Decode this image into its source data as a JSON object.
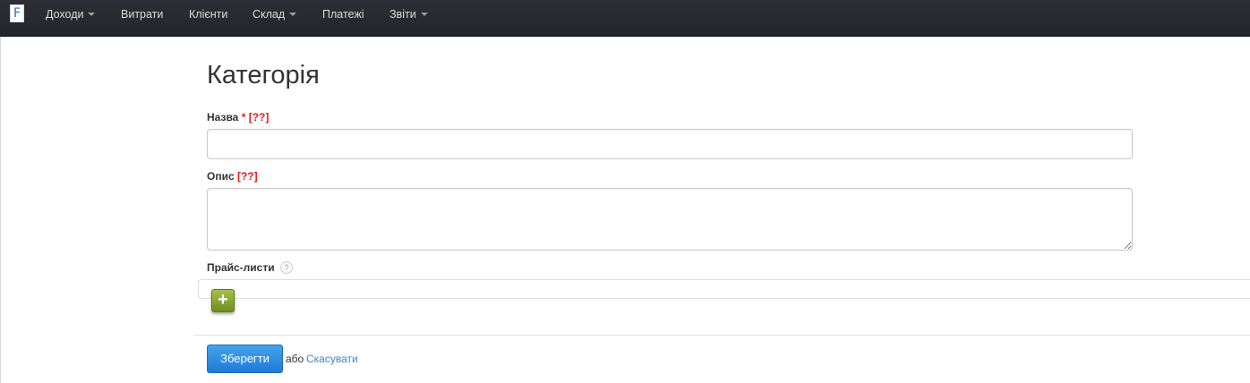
{
  "navbar": {
    "brand_glyph": "F",
    "items": [
      {
        "label": "Доходи",
        "dropdown": true
      },
      {
        "label": "Витрати",
        "dropdown": false
      },
      {
        "label": "Клієнти",
        "dropdown": false
      },
      {
        "label": "Склад",
        "dropdown": true
      },
      {
        "label": "Платежі",
        "dropdown": false
      },
      {
        "label": "Звіти",
        "dropdown": true
      }
    ]
  },
  "form": {
    "title": "Категорія",
    "name_field": {
      "label": "Назва",
      "required_mark": "*",
      "hint": "[??]",
      "value": ""
    },
    "description_field": {
      "label": "Опис",
      "hint": "[??]",
      "value": ""
    },
    "price_lists": {
      "label": "Прайс-листи",
      "help_glyph": "?",
      "add_glyph": "+"
    },
    "actions": {
      "save_label": "Зберегти",
      "or_text": "або",
      "cancel_label": "Скасувати"
    }
  },
  "colors": {
    "navbar_bg": "#25282c",
    "required": "#e01b1b",
    "primary_button": "#2b8ae0",
    "add_button": "#8aaa33",
    "link": "#3a87c8"
  }
}
